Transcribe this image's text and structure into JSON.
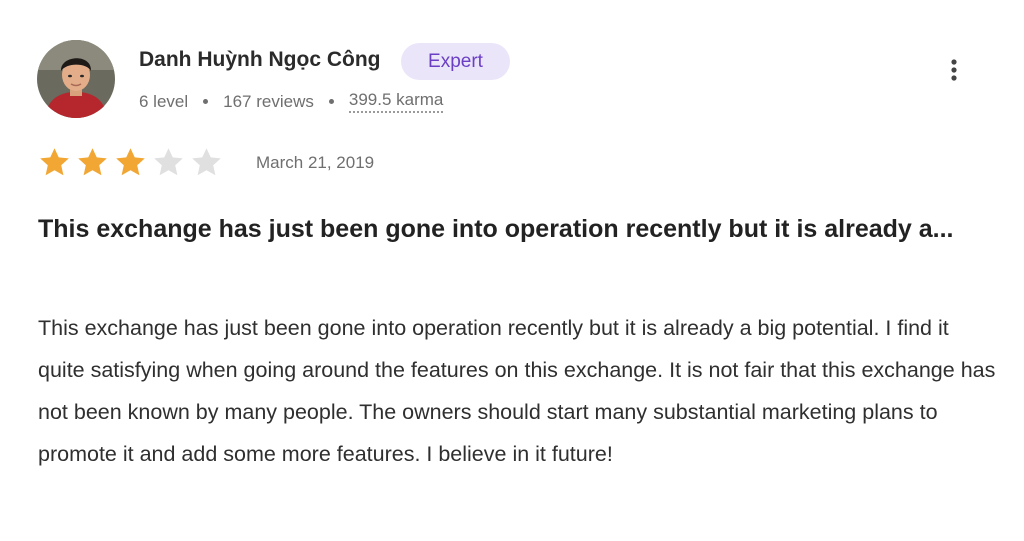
{
  "author": {
    "name": "Danh Huỳnh Ngọc Công",
    "badge": "Expert",
    "level": "6 level",
    "reviews": "167 reviews",
    "karma": "399.5 karma",
    "avatar_icon": "user-photo-avatar"
  },
  "review": {
    "rating": 3,
    "max_rating": 5,
    "date": "March 21, 2019",
    "title": "This exchange has just been gone into operation recently but it is already a...",
    "body": "This exchange has just been gone into operation recently but it is already a big potential. I find it quite satisfying when going around the features on this exchange. It is not fair that this exchange has not been known by many people. The owners should start many substantial marketing plans to promote it and add some more features. I believe in it future!"
  },
  "actions": {
    "more_icon": "more-vertical-icon"
  },
  "colors": {
    "star_filled": "#f2a633",
    "star_empty": "#e0e0e0",
    "badge_bg": "#ebe5fa",
    "badge_text": "#6b3fc4"
  }
}
